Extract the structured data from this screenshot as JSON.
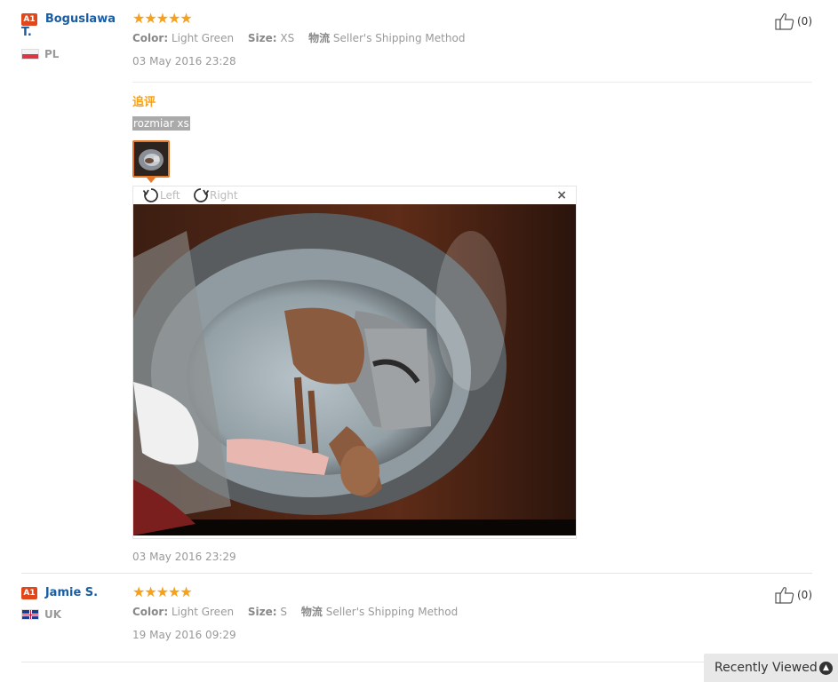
{
  "reviews": [
    {
      "badge": "A1",
      "username": "Boguslawa T.",
      "country": "PL",
      "stars": "★★★★★",
      "attributes": {
        "color_label": "Color:",
        "color_value": "Light Green",
        "size_label": "Size:",
        "size_value": "XS",
        "logistics_label": "物流",
        "logistics_value": "Seller's Shipping Method"
      },
      "date": "03 May 2016 23:28",
      "likes": "(0)",
      "followup": {
        "title": "追评",
        "text": "rozmiar xs",
        "date": "03 May 2016 23:29",
        "viewer": {
          "rotate_left_label": "Left",
          "rotate_right_label": "Right",
          "close_label": "×"
        }
      }
    },
    {
      "badge": "A1",
      "username": "Jamie S.",
      "country": "UK",
      "stars": "★★★★★",
      "attributes": {
        "color_label": "Color:",
        "color_value": "Light Green",
        "size_label": "Size:",
        "size_value": "S",
        "logistics_label": "物流",
        "logistics_value": "Seller's Shipping Method"
      },
      "date": "19 May 2016 09:29",
      "likes": "(0)"
    }
  ],
  "recently_viewed": {
    "label": "Recently Viewed",
    "icon": "chevron-up-icon"
  },
  "colors": {
    "username": "#1a5da3",
    "stars": "#f7a11a",
    "badge": "#e0471b",
    "followup_title": "#f7a11a",
    "thumb_border": "#e4782a"
  }
}
